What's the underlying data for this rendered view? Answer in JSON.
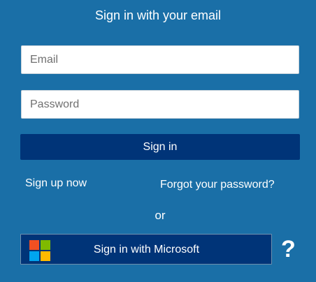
{
  "heading": "Sign in with your email",
  "form": {
    "email_placeholder": "Email",
    "password_placeholder": "Password",
    "signin_label": "Sign in"
  },
  "links": {
    "signup": "Sign up now",
    "forgot_password": "Forgot your password?"
  },
  "separator": "or",
  "social": {
    "microsoft_label": "Sign in with Microsoft",
    "logo_icon": "microsoft-logo-icon",
    "logo_colors": [
      "#f25022",
      "#7fba00",
      "#00a4ef",
      "#ffb900"
    ]
  },
  "help": {
    "icon": "question-mark-icon",
    "label": "?"
  },
  "colors": {
    "background": "#1a6fa7",
    "button": "#003478",
    "text": "#ffffff"
  }
}
